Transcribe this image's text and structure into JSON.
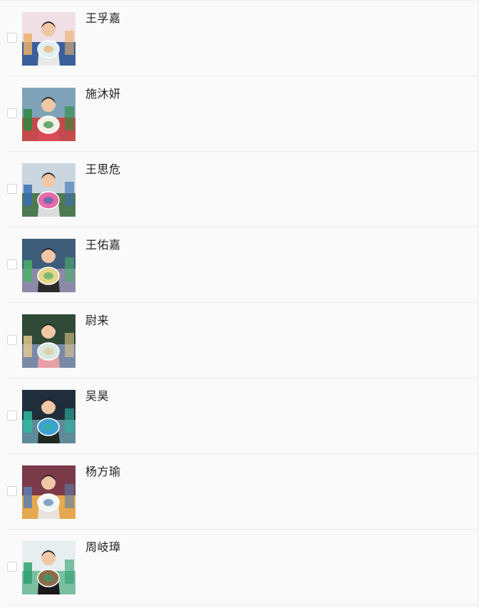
{
  "list": {
    "items": [
      {
        "name": "王孚嘉",
        "photo": {
          "sky": "#f0dfe4",
          "ground": "#3a5f9c",
          "accent": "#e9b06a",
          "shirt": "#e9e9e7",
          "plate": "#dff0f7"
        }
      },
      {
        "name": "施沐妍",
        "photo": {
          "sky": "#7fa3b8",
          "ground": "#c44b4b",
          "accent": "#2d8a3e",
          "shirt": "#d94a5a",
          "plate": "#f3f0e8"
        }
      },
      {
        "name": "王思危",
        "photo": {
          "sky": "#c9d6e0",
          "ground": "#4e7a52",
          "accent": "#3b6eb0",
          "shirt": "#dcdcdc",
          "plate": "#e86aa6"
        }
      },
      {
        "name": "王佑嘉",
        "photo": {
          "sky": "#3d5d7a",
          "ground": "#8c8aa8",
          "accent": "#4caf6a",
          "shirt": "#2a2a2a",
          "plate": "#e7d68a"
        }
      },
      {
        "name": "尉来",
        "photo": {
          "sky": "#2f4a36",
          "ground": "#7a8aa6",
          "accent": "#e0c890",
          "shirt": "#e8a0a8",
          "plate": "#d8e8e0"
        }
      },
      {
        "name": "吴昊",
        "photo": {
          "sky": "#1f2e3a",
          "ground": "#5e8a9a",
          "accent": "#2fb8a0",
          "shirt": "#1e2a22",
          "plate": "#3f9fd0"
        }
      },
      {
        "name": "杨方瑜",
        "photo": {
          "sky": "#7a3a4a",
          "ground": "#e6a84c",
          "accent": "#5a7fb0",
          "shirt": "#e8e2dc",
          "plate": "#f2f6f4"
        }
      },
      {
        "name": "周岐璋",
        "photo": {
          "sky": "#e6eef0",
          "ground": "#7ac0a0",
          "accent": "#2f9f6f",
          "shirt": "#1a1a1a",
          "plate": "#8d6b4a"
        }
      }
    ]
  }
}
